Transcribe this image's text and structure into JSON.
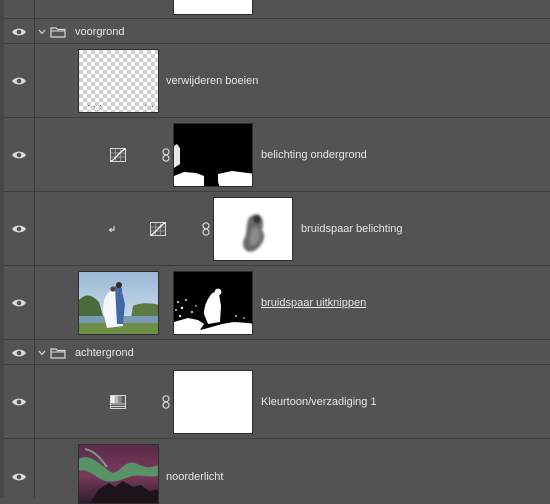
{
  "layers": [
    {
      "id": "top-partial",
      "kind": "partial",
      "visible": true
    },
    {
      "id": "voorgrond",
      "kind": "group",
      "name": "voorgrond",
      "expanded": true,
      "visible": true
    },
    {
      "id": "verwijderen",
      "kind": "pixel",
      "name": "verwijderen boeien",
      "visible": true
    },
    {
      "id": "belichting-ondergrond",
      "kind": "adjustment",
      "name": "belichting ondergrond",
      "adjustment_icon": "curves-adjustment-icon",
      "visible": true
    },
    {
      "id": "bruidspaar-belichting",
      "kind": "adjustment",
      "name": "bruidspaar belichting",
      "adjustment_icon": "curves-adjustment-icon",
      "clipped": true,
      "visible": true
    },
    {
      "id": "bruidspaar-uitknippen",
      "kind": "pixel-mask",
      "name": "bruidspaar uitknippen",
      "selected_underline": true,
      "visible": true
    },
    {
      "id": "achtergrond",
      "kind": "group",
      "name": "achtergrond",
      "expanded": true,
      "visible": true
    },
    {
      "id": "kleurtoon",
      "kind": "adjustment",
      "name": "Kleurtoon/verzadiging 1",
      "adjustment_icon": "hue-saturation-adjustment-icon",
      "visible": true
    },
    {
      "id": "noorderlicht",
      "kind": "pixel",
      "name": "noorderlicht",
      "visible": true
    }
  ],
  "colors": {
    "panel": "#535353",
    "divider": "#3e3e3e",
    "text": "#e6e6e6"
  }
}
